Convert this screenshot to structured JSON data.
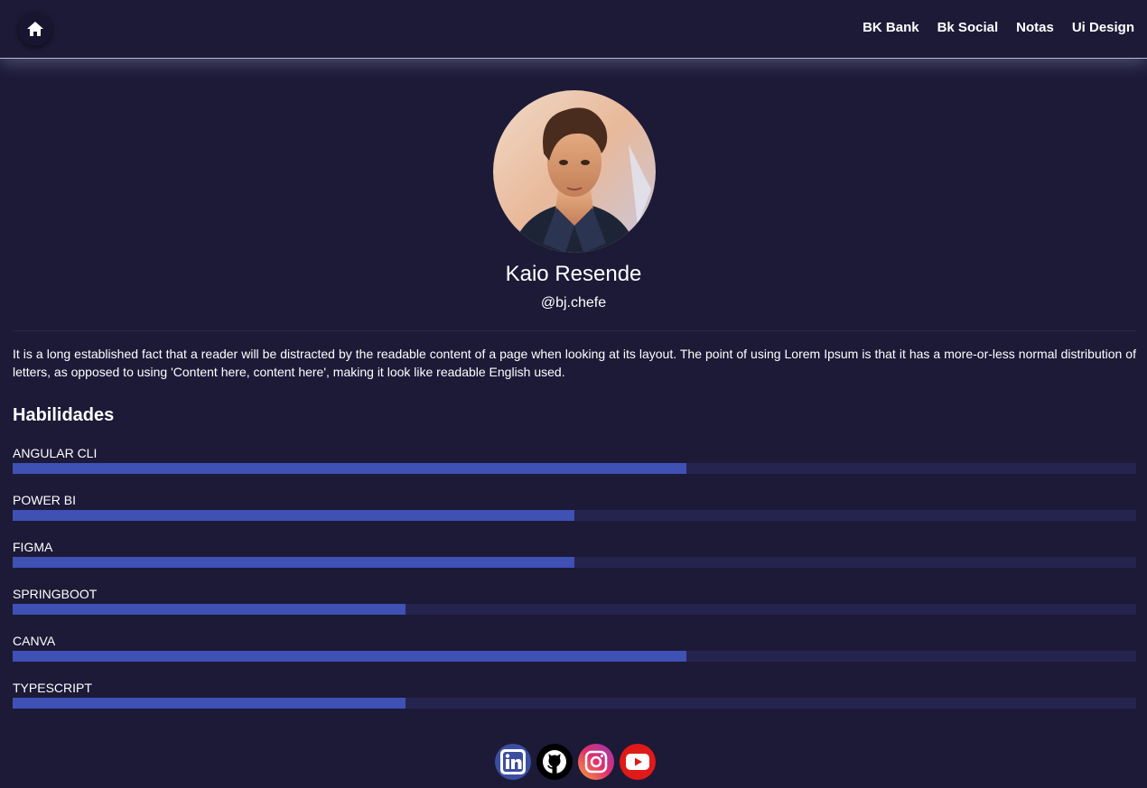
{
  "nav": {
    "home_icon": "home-icon",
    "links": [
      "BK Bank",
      "Bk Social",
      "Notas",
      "Ui Design"
    ]
  },
  "profile": {
    "name": "Kaio Resende",
    "handle": "@bj.chefe",
    "bio": "It is a long established fact that a reader will be distracted by the readable content of a page when looking at its layout. The point of using Lorem Ipsum is that it has a more-or-less normal distribution of letters, as opposed to using 'Content here, content here', making it look like readable English used."
  },
  "skills": {
    "title": "Habilidades",
    "items": [
      {
        "label": "ANGULAR CLI",
        "level": 0.6
      },
      {
        "label": "POWER BI",
        "level": 0.5
      },
      {
        "label": "FIGMA",
        "level": 0.5
      },
      {
        "label": "SPRINGBOOT",
        "level": 0.35
      },
      {
        "label": "CANVA",
        "level": 0.6
      },
      {
        "label": "TYPESCRIPT",
        "level": 0.35
      }
    ]
  },
  "social": [
    "linkedin-icon",
    "github-icon",
    "instagram-icon",
    "youtube-icon"
  ],
  "colors": {
    "background": "#1c1a37",
    "bar_fill": "#3f51b5",
    "bar_track": "#25244f"
  }
}
